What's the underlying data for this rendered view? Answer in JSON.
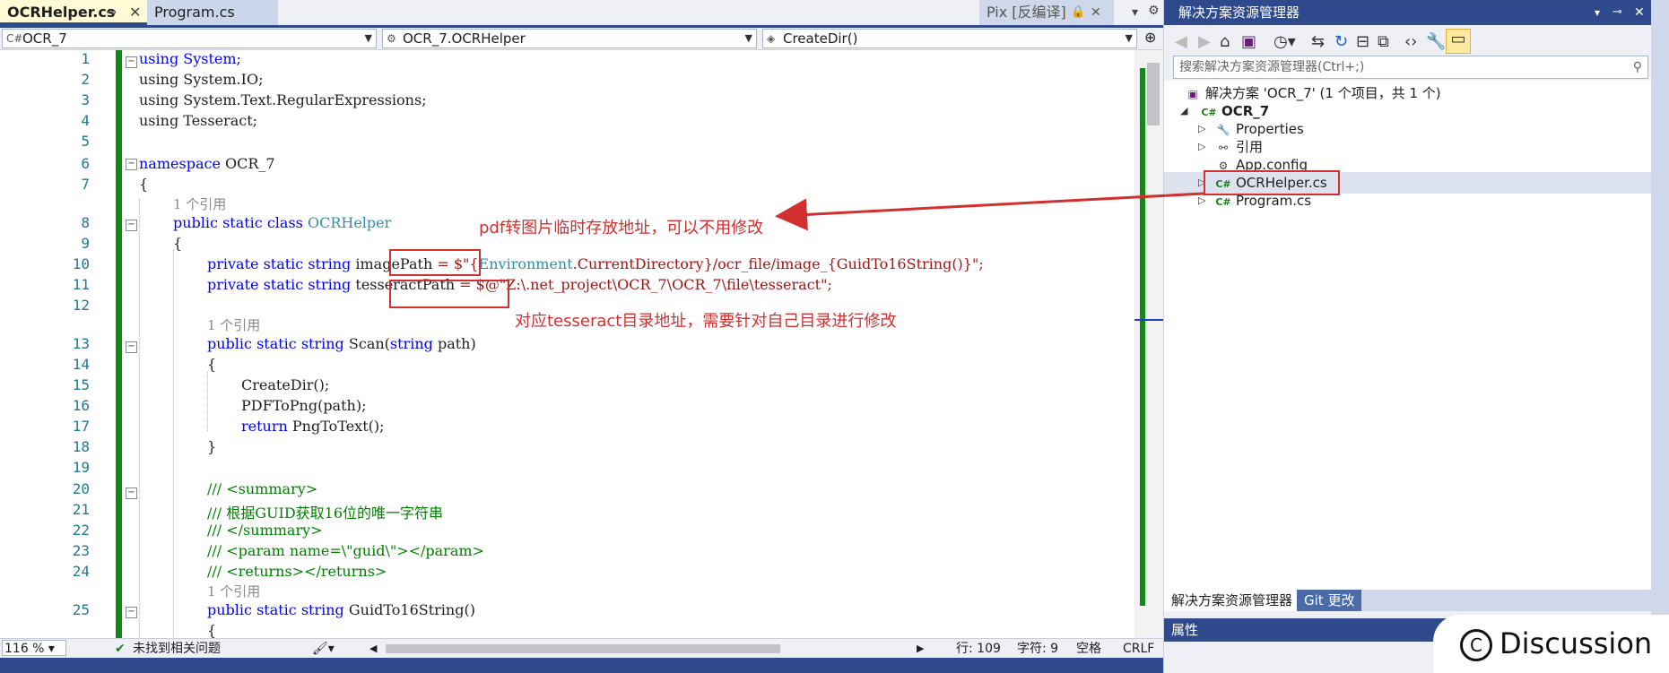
{
  "tabs": [
    {
      "label": "OCRHelper.cs",
      "active": true
    },
    {
      "label": "Program.cs",
      "active": false
    }
  ],
  "pix_label": "Pix [反编译]",
  "nav": {
    "project": "OCR_7",
    "class": "OCR_7.OCRHelper",
    "member": "CreateDir()"
  },
  "code_lines": [
    {
      "num": "1"
    },
    {
      "num": "2"
    },
    {
      "num": "3"
    },
    {
      "num": "4"
    },
    {
      "num": "5"
    },
    {
      "num": "6"
    },
    {
      "num": "7"
    },
    {
      "num": "8"
    },
    {
      "num": "9"
    },
    {
      "num": "10"
    },
    {
      "num": "11"
    },
    {
      "num": "12"
    },
    {
      "num": "13"
    },
    {
      "num": "14"
    },
    {
      "num": "15"
    },
    {
      "num": "16"
    },
    {
      "num": "17"
    },
    {
      "num": "18"
    },
    {
      "num": "19"
    },
    {
      "num": "20"
    },
    {
      "num": "21"
    },
    {
      "num": "22"
    },
    {
      "num": "23"
    },
    {
      "num": "24"
    },
    {
      "num": "25"
    }
  ],
  "code": {
    "l1": "using System;",
    "l2": "using System.IO;",
    "l3": "using System.Text.RegularExpressions;",
    "l4": "using Tesseract;",
    "l6a": "namespace",
    "l6b": " OCR_7",
    "l7": "{",
    "ref1": "1 个引用",
    "l8a": "public static class ",
    "l8b": "OCRHelper",
    "l9": "{",
    "l10a": "private static string ",
    "l10b": "imagePath",
    "l10c": " = $\"{",
    "l10d": "Environment",
    "l10e": ".CurrentDirectory}/ocr_file/image_{GuidTo16String()}\";",
    "l11a": "private static string ",
    "l11b": "tesseractPath",
    "l11c": " = $@\"Z:\\.net_project\\OCR_7\\OCR_7\\file\\tesseract\";",
    "ref2": "1 个引用",
    "l13a": "public static string ",
    "l13b": "Scan(",
    "l13c": "string",
    "l13d": " path)",
    "l14": "{",
    "l15": "CreateDir();",
    "l16": "PDFToPng(path);",
    "l17a": "return ",
    "l17b": "PngToText();",
    "l18": "}",
    "l20": "/// <summary>",
    "l21": "/// 根据GUID获取16位的唯一字符串",
    "l22": "/// </summary>",
    "l23": "/// <param name=\\\"guid\\\"></param>",
    "l24": "/// <returns></returns>",
    "ref3": "1 个引用",
    "l25a": "public static string ",
    "l25b": "GuidTo16String()",
    "l26": "{"
  },
  "annotations": {
    "note1": "pdf转图片临时存放地址，可以不用修改",
    "note2": "对应tesseract目录地址，需要针对自己目录进行修改"
  },
  "status": {
    "zoom": "116 %",
    "issues": "未找到相关问题",
    "line": "行: 109",
    "char": "字符: 9",
    "spaces": "空格",
    "eol": "CRLF"
  },
  "solution_explorer": {
    "title": "解决方案资源管理器",
    "search_placeholder": "搜索解决方案资源管理器(Ctrl+;)",
    "solution": "解决方案 'OCR_7' (1 个项目，共 1 个)",
    "project": "OCR_7",
    "items": [
      "Properties",
      "引用",
      "App.config",
      "OCRHelper.cs",
      "Program.cs"
    ],
    "tab1": "解决方案资源管理器",
    "tab2": "Git 更改",
    "properties": "属性"
  },
  "watermark": "Discussion",
  "colors": {
    "accent": "#2f4a8c",
    "annotation": "#d32f2f",
    "change_bar": "#118a11"
  }
}
